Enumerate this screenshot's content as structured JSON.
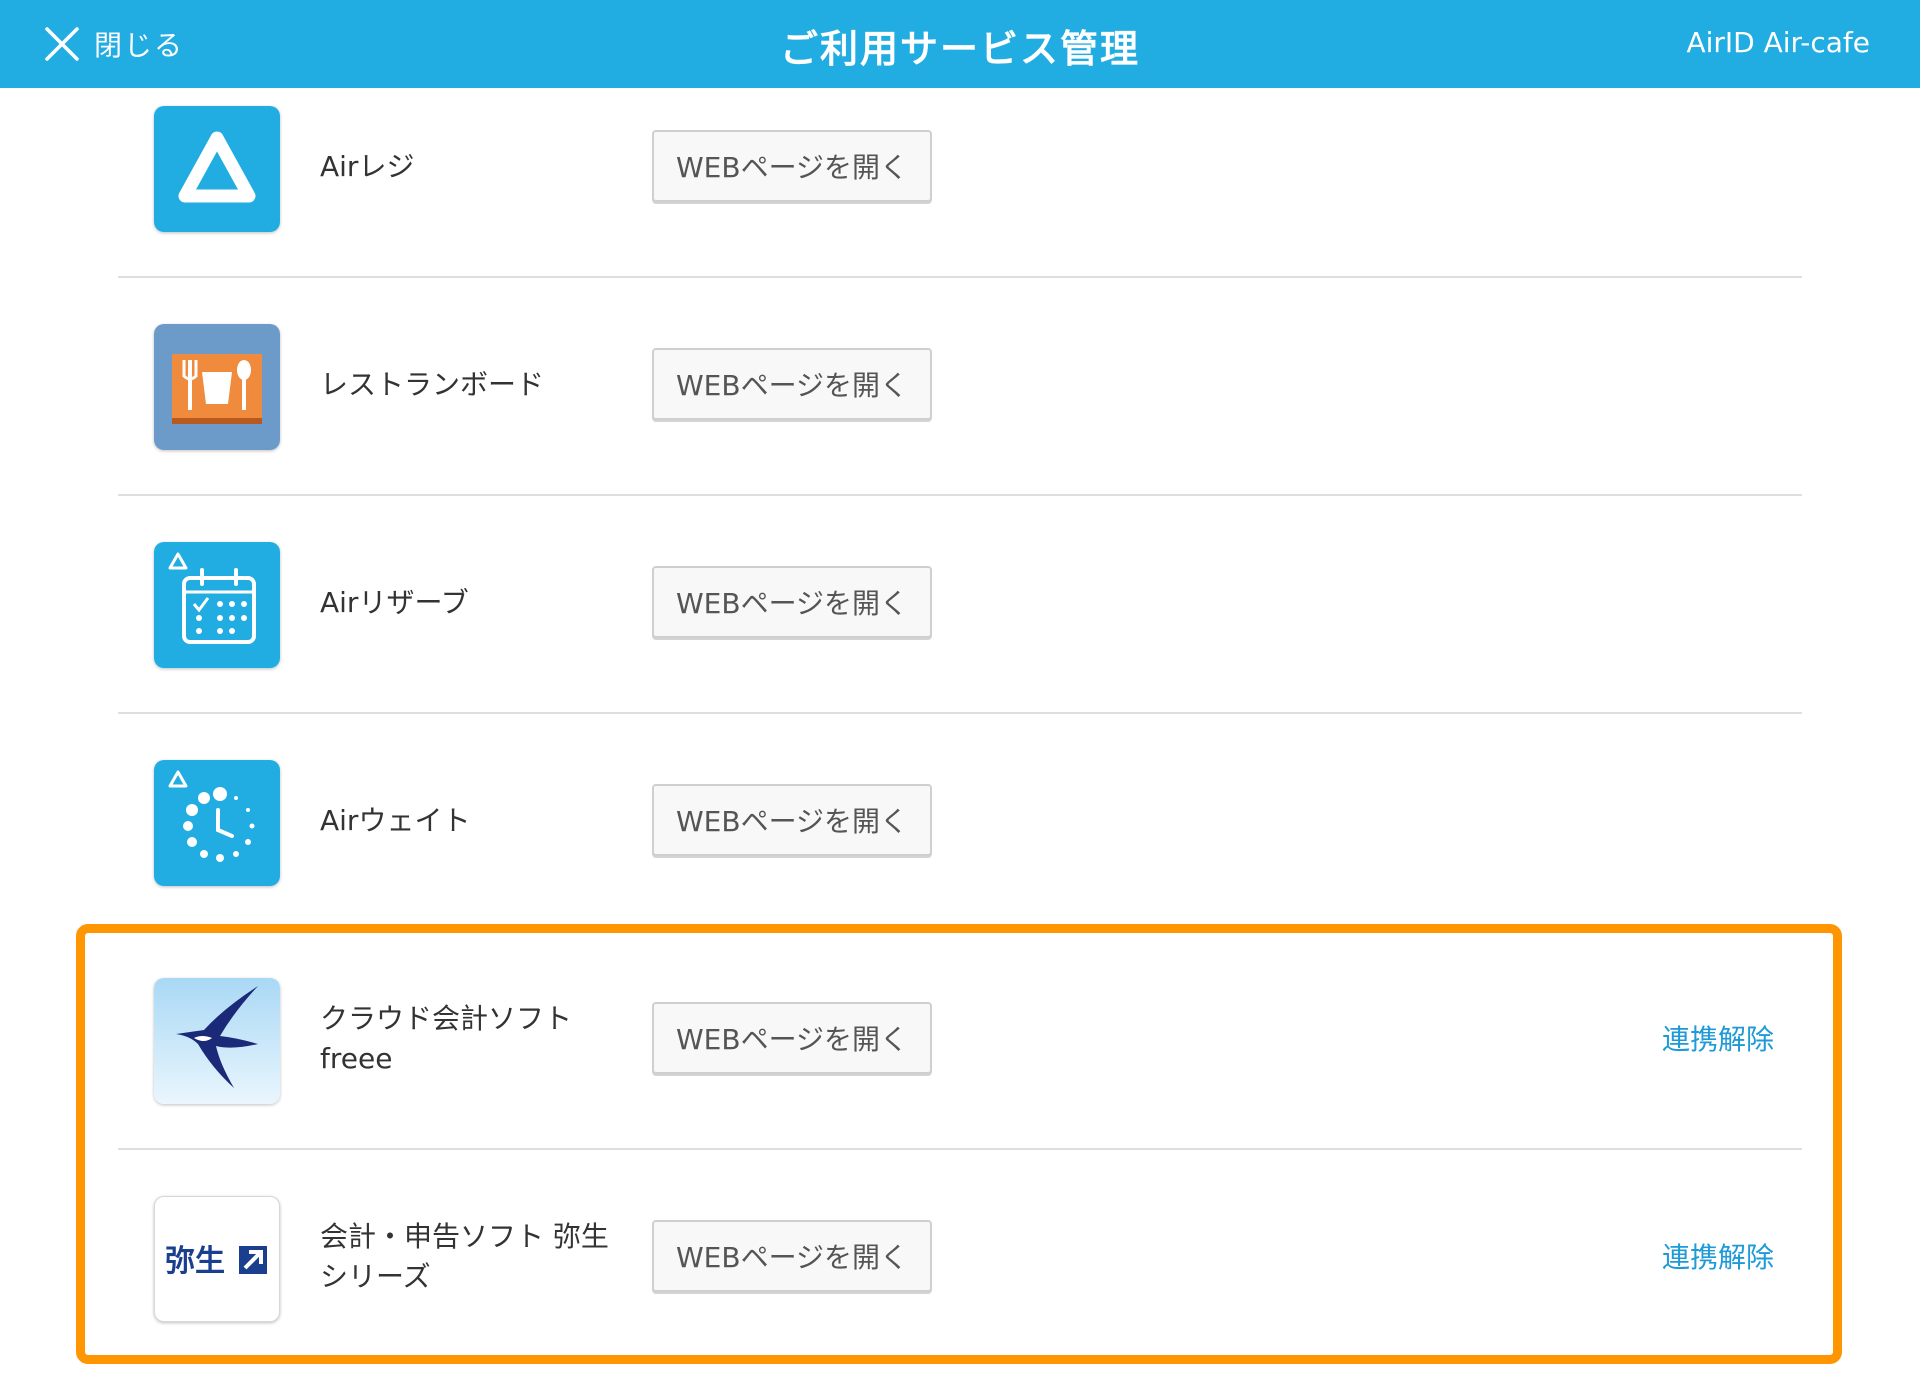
{
  "header": {
    "close_label": "閉じる",
    "title": "ご利用サービス管理",
    "account": "AirID Air-cafe",
    "background": "#21ace2"
  },
  "services": [
    {
      "name_line1": "Airレジ",
      "name_line2": "",
      "button": "WEBページを開く",
      "icon": "air-regi-icon"
    },
    {
      "name_line1": "レストランボード",
      "name_line2": "",
      "button": "WEBページを開く",
      "icon": "restaurant-board-icon"
    },
    {
      "name_line1": "Airリザーブ",
      "name_line2": "",
      "button": "WEBページを開く",
      "icon": "air-reserve-icon"
    },
    {
      "name_line1": "Airウェイト",
      "name_line2": "",
      "button": "WEBページを開く",
      "icon": "air-wait-icon"
    },
    {
      "name_line1": "クラウド会計ソフト",
      "name_line2": "freee",
      "button": "WEBページを開く",
      "unlink": "連携解除",
      "icon": "freee-swallow-icon"
    },
    {
      "name_line1": "会計・申告ソフト 弥生",
      "name_line2": "シリーズ",
      "button": "WEBページを開く",
      "unlink": "連携解除",
      "icon": "yayoi-logo-icon",
      "logo_text": "弥生"
    }
  ],
  "colors": {
    "highlight": "#ff9500",
    "link": "#1e9ad8",
    "air_blue": "#21ace2"
  }
}
